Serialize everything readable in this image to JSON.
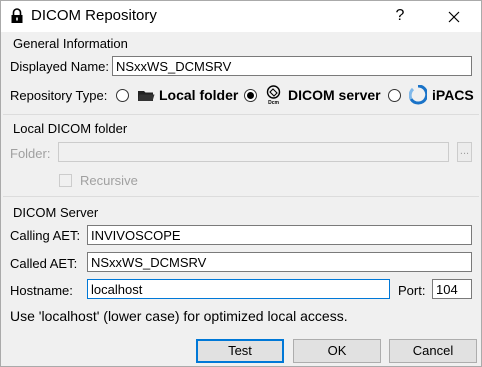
{
  "window": {
    "title": "DICOM Repository",
    "help_label": "?",
    "icons": {
      "app": "lock-icon",
      "close": "close-icon"
    }
  },
  "general": {
    "title": "General Information",
    "displayed_name_label": "Displayed Name:",
    "displayed_name_value": "NSxxWS_DCMSRV",
    "repository_type_label": "Repository Type:",
    "options": [
      {
        "label": "Local folder",
        "icon": "folder-icon",
        "selected": false
      },
      {
        "label": "DICOM server",
        "icon": "dicom-icon",
        "selected": true
      },
      {
        "label": "iPACS",
        "icon": "ipacs-logo-icon",
        "selected": false
      }
    ]
  },
  "local_folder": {
    "title": "Local DICOM folder",
    "folder_label": "Folder:",
    "folder_value": "",
    "browse_label": "...",
    "recursive_label": "Recursive",
    "recursive_checked": false
  },
  "dicom_server": {
    "title": "DICOM Server",
    "calling_aet_label": "Calling AET:",
    "calling_aet_value": "INVIVOSCOPE",
    "called_aet_label": "Called AET:",
    "called_aet_value": "NSxxWS_DCMSRV",
    "hostname_label": "Hostname:",
    "hostname_value": "localhost",
    "port_label": "Port:",
    "port_value": "104",
    "hint": "Use 'localhost' (lower case) for optimized local access."
  },
  "buttons": {
    "test": "Test",
    "ok": "OK",
    "cancel": "Cancel"
  },
  "colors": {
    "accent": "#0078d7",
    "ipacs_blue": "#1a73c8",
    "disabled_text": "#a0a0a0"
  }
}
